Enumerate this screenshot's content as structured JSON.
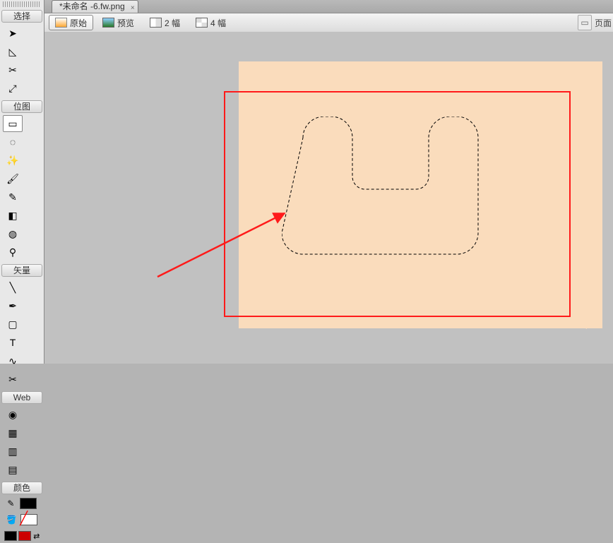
{
  "document": {
    "tab_title": "*未命名 -6.fw.png"
  },
  "viewbar": {
    "orig": "原始",
    "preview": "预览",
    "two_up": "2 幅",
    "four_up": "4 幅",
    "page_label": "页面"
  },
  "toolbox": {
    "groups": {
      "select": "选择",
      "bitmap": "位图",
      "vector": "矢量",
      "web": "Web",
      "color": "颜色"
    }
  },
  "colors": {
    "canvas_bg": "#c1c1c1",
    "artboard": "#fadcbc",
    "highlight": "#ff1a1a",
    "stroke_swatch": "#000000",
    "fill_swatch": "#ffffff",
    "fg": "#000000",
    "bg": "#cc0000"
  }
}
